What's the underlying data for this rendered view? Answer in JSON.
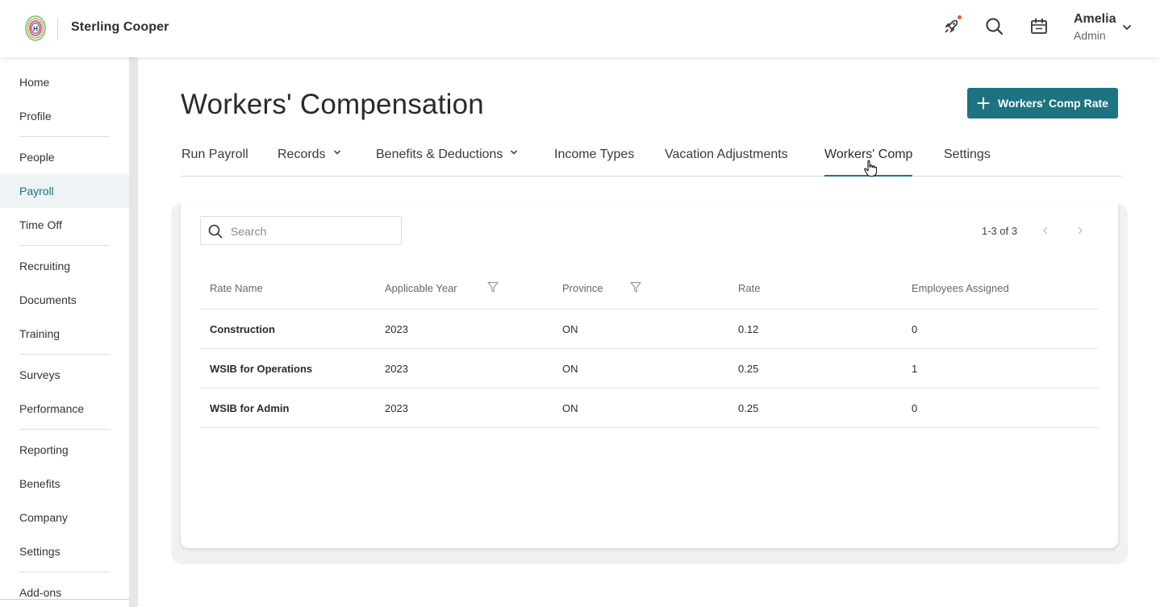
{
  "header": {
    "company_name": "Sterling Cooper",
    "user_name": "Amelia",
    "user_role": "Admin",
    "icons": [
      "logo-icon",
      "rocket-icon",
      "search-icon",
      "calendar-icon",
      "chevron-down-icon"
    ],
    "notification_dot_color": "#e4572e"
  },
  "sidebar": {
    "active": "Payroll",
    "items": [
      "Home",
      "Profile",
      "People",
      "Payroll",
      "Time Off",
      "Recruiting",
      "Documents",
      "Training",
      "Surveys",
      "Performance",
      "Reporting",
      "Benefits",
      "Company",
      "Settings",
      "Add-ons"
    ]
  },
  "page": {
    "title": "Workers' Compensation",
    "add_button_label": "Workers' Comp Rate"
  },
  "tabs": {
    "items": [
      "Run Payroll",
      "Records",
      "Benefits & Deductions",
      "Income Types",
      "Vacation Adjustments",
      "Workers' Comp",
      "Settings"
    ],
    "active": "Workers' Comp"
  },
  "table_card": {
    "search_placeholder": "Search",
    "pagination": "1-3 of 3",
    "columns": [
      "Rate Name",
      "Applicable Year",
      "Province",
      "Rate",
      "Employees Assigned"
    ],
    "rows": [
      [
        "Construction",
        "2023",
        "ON",
        "0.12",
        "0"
      ],
      [
        "WSIB for Operations",
        "2023",
        "ON",
        "0.25",
        "1"
      ],
      [
        "WSIB for Admin",
        "2023",
        "ON",
        "0.25",
        "0"
      ]
    ]
  },
  "colors": {
    "accent": "#1d7381",
    "active_nav_bg": "#eef3f6",
    "active_nav_text": "#1f6e82"
  }
}
